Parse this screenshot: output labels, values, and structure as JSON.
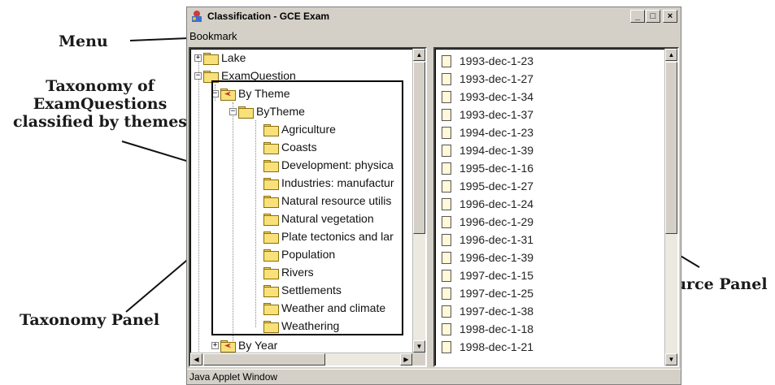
{
  "window": {
    "title": "Classification - GCE Exam",
    "controls": {
      "minimize": "_",
      "maximize": "□",
      "close": "×"
    }
  },
  "menubar": {
    "items": [
      "Bookmark"
    ]
  },
  "annotations": {
    "menu": "Menu",
    "taxonomy_line1": "Taxonomy of",
    "taxonomy_line2": "ExamQuestions",
    "taxonomy_line3": "classified by themes",
    "taxonomy_panel": "Taxonomy Panel",
    "resource_panel": "Resource Panel"
  },
  "tree": {
    "lake": "Lake",
    "exam_question": "ExamQuestion",
    "by_theme_root": "By Theme",
    "by_theme_child": "ByTheme",
    "themes": [
      "Agriculture",
      "Coasts",
      "Development: physica",
      "Industries: manufactur",
      "Natural resource utilis",
      "Natural vegetation",
      "Plate tectonics and lar",
      "Population",
      "Rivers",
      "Settlements",
      "Weather and climate",
      "Weathering"
    ],
    "by_year": "By Year"
  },
  "resources": [
    "1993-dec-1-23",
    "1993-dec-1-27",
    "1993-dec-1-34",
    "1993-dec-1-37",
    "1994-dec-1-23",
    "1994-dec-1-39",
    "1995-dec-1-16",
    "1995-dec-1-27",
    "1996-dec-1-24",
    "1996-dec-1-29",
    "1996-dec-1-31",
    "1996-dec-1-39",
    "1997-dec-1-15",
    "1997-dec-1-25",
    "1997-dec-1-38",
    "1998-dec-1-18",
    "1998-dec-1-21"
  ],
  "status": {
    "text": "Java Applet Window"
  },
  "icons": {
    "app": "app-icon",
    "folder": "folder-icon",
    "theme": "theme-folder-icon",
    "document": "document-icon"
  }
}
